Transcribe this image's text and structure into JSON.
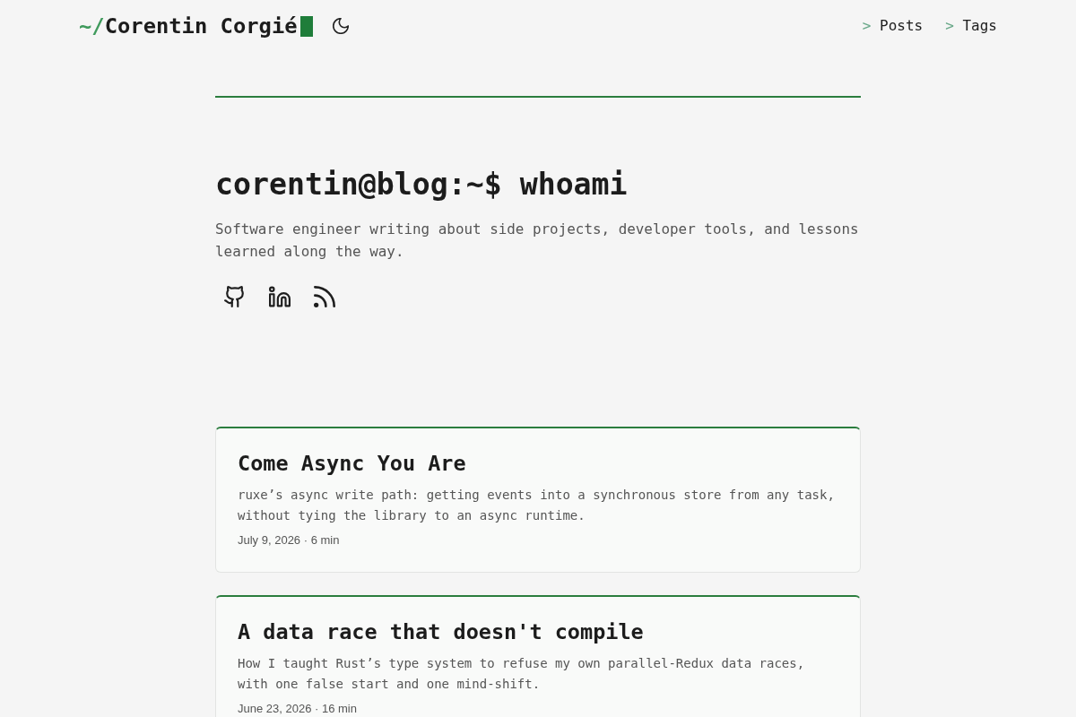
{
  "header": {
    "logo": {
      "prefix": "~/",
      "name": "Corentin Corgié"
    },
    "nav": [
      {
        "prompt": ">",
        "label": "Posts"
      },
      {
        "prompt": ">",
        "label": "Tags"
      }
    ]
  },
  "hero": {
    "title": "corentin@blog:~$ whoami",
    "bio": "Software engineer writing about side projects, developer tools, and lessons learned along the way.",
    "links": [
      {
        "kind": "github"
      },
      {
        "kind": "linkedin"
      },
      {
        "kind": "rss"
      }
    ]
  },
  "posts": [
    {
      "title": "Come Async You Are",
      "summary": "ruxe’s async write path: getting events into a synchronous store from any task, without tying the library to an async runtime.",
      "meta": "July 9, 2026 · 6 min"
    },
    {
      "title": "A data race that doesn't compile",
      "summary": "How I taught Rust’s type system to refuse my own parallel-Redux data races, with one false start and one mind-shift.",
      "meta": "June 23, 2026 · 16 min"
    }
  ]
}
